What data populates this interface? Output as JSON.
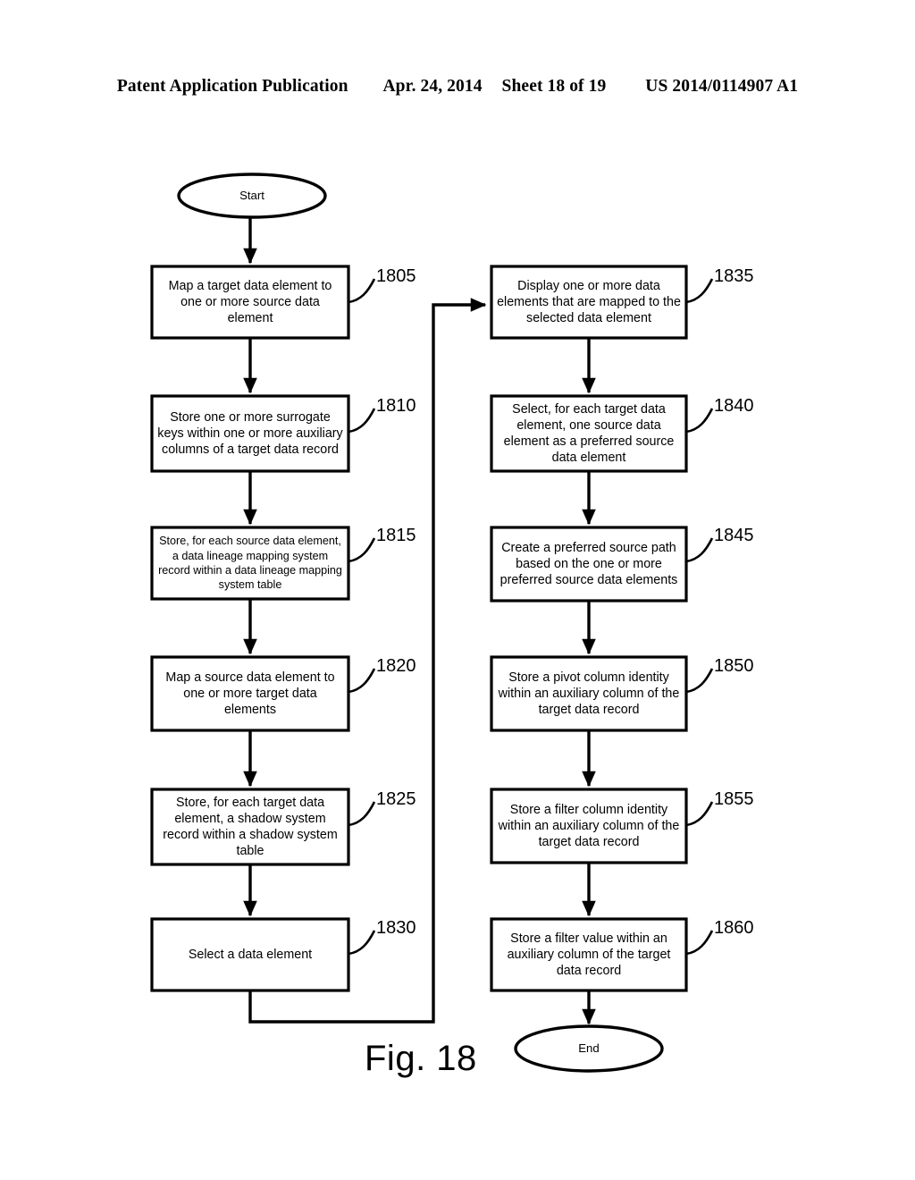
{
  "header": {
    "publication": "Patent Application Publication",
    "date": "Apr. 24, 2014",
    "sheet": "Sheet 18 of 19",
    "number": "US 2014/0114907 A1"
  },
  "figure": {
    "caption": "Fig. 18",
    "start_label": "Start",
    "end_label": "End"
  },
  "colors": {
    "stroke": "#000000",
    "fill": "#ffffff",
    "background": "#ffffff"
  },
  "flowchart": {
    "left_column": [
      {
        "ref": "1805",
        "text": "Map a target data element to one or more source data element"
      },
      {
        "ref": "1810",
        "text": "Store one or more surrogate keys within one or more auxiliary columns of a target data record"
      },
      {
        "ref": "1815",
        "text": "Store, for each source data element, a data lineage mapping system record within a data lineage mapping system table"
      },
      {
        "ref": "1820",
        "text": "Map a source data element to one or more target data elements"
      },
      {
        "ref": "1825",
        "text": "Store, for each target data element, a shadow system record within a shadow system table"
      },
      {
        "ref": "1830",
        "text": "Select a data element"
      }
    ],
    "right_column": [
      {
        "ref": "1835",
        "text": "Display one or more data elements that are mapped to the selected data element"
      },
      {
        "ref": "1840",
        "text": "Select, for each target data element, one source data element as a preferred source data element"
      },
      {
        "ref": "1845",
        "text": "Create a preferred source path based on the one or more preferred source data elements"
      },
      {
        "ref": "1850",
        "text": "Store a pivot column identity within an auxiliary column of the target data record"
      },
      {
        "ref": "1855",
        "text": "Store a filter column identity within an auxiliary column of the target data record"
      },
      {
        "ref": "1860",
        "text": "Store a filter value within an auxiliary column of the target data record"
      }
    ]
  }
}
